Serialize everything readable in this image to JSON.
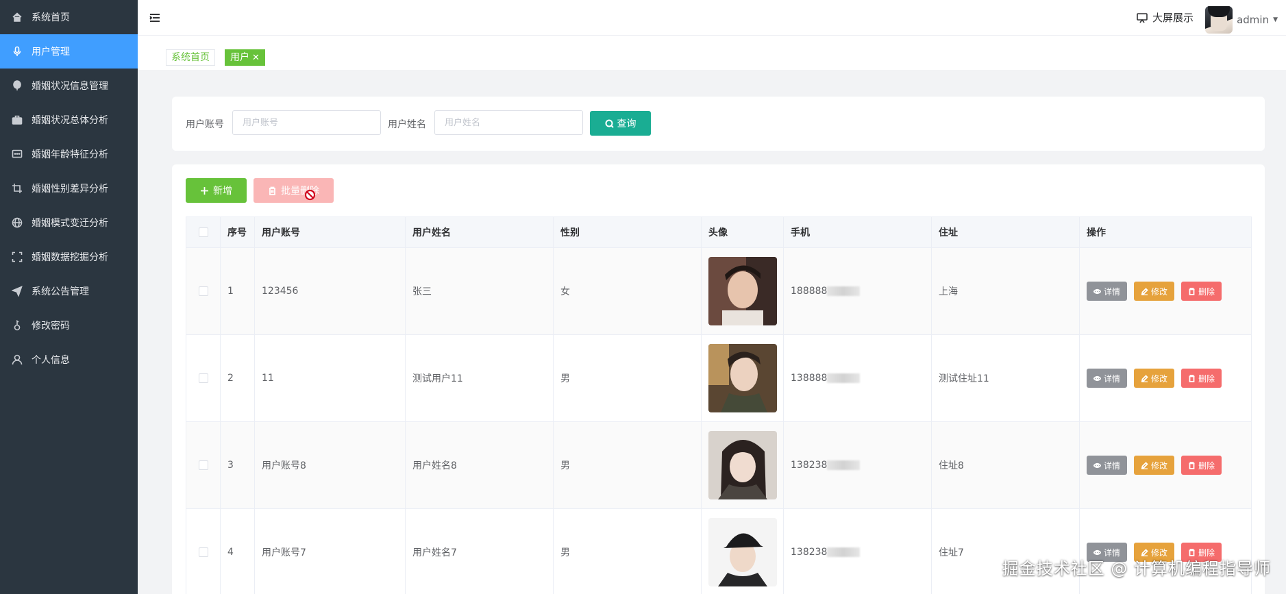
{
  "sidebar": {
    "items": [
      {
        "label": "系统首页",
        "icon": "home-icon"
      },
      {
        "label": "用户管理",
        "icon": "microphone-icon"
      },
      {
        "label": "婚姻状况信息管理",
        "icon": "balloon-icon"
      },
      {
        "label": "婚姻状况总体分析",
        "icon": "briefcase-icon"
      },
      {
        "label": "婚姻年龄特征分析",
        "icon": "chat-dots-icon"
      },
      {
        "label": "婚姻性别差异分析",
        "icon": "crop-icon"
      },
      {
        "label": "婚姻模式变迁分析",
        "icon": "globe-icon"
      },
      {
        "label": "婚姻数据挖掘分析",
        "icon": "full-screen-icon"
      },
      {
        "label": "系统公告管理",
        "icon": "send-icon"
      },
      {
        "label": "修改密码",
        "icon": "key-icon"
      },
      {
        "label": "个人信息",
        "icon": "user-icon"
      }
    ],
    "active_index": 1,
    "colors": {
      "background": "#2b3640",
      "active": "#409eff"
    }
  },
  "header": {
    "screen_label": "大屏展示",
    "username": "admin"
  },
  "tabs": {
    "home": "系统首页",
    "current": "用户"
  },
  "search": {
    "account_label": "用户账号",
    "account_placeholder": "用户账号",
    "name_label": "用户姓名",
    "name_placeholder": "用户姓名",
    "button_label": "查询"
  },
  "toolbar": {
    "add_label": "新增",
    "batch_delete_label": "批量删除"
  },
  "table": {
    "columns": [
      "序号",
      "用户账号",
      "用户姓名",
      "性别",
      "头像",
      "手机",
      "住址",
      "操作"
    ],
    "rows": [
      {
        "index": "1",
        "account": "123456",
        "name": "张三",
        "gender": "女",
        "phone": "188888",
        "address": "上海"
      },
      {
        "index": "2",
        "account": "11",
        "name": "测试用户11",
        "gender": "男",
        "phone": "138888",
        "address": "测试住址11"
      },
      {
        "index": "3",
        "account": "用户账号8",
        "name": "用户姓名8",
        "gender": "男",
        "phone": "138238",
        "address": "住址8"
      },
      {
        "index": "4",
        "account": "用户账号7",
        "name": "用户姓名7",
        "gender": "男",
        "phone": "138238",
        "address": "住址7"
      }
    ],
    "actions": {
      "detail": "详情",
      "edit": "修改",
      "delete": "删除"
    }
  },
  "watermark": "掘金技术社区 @ 计算机编程指导师"
}
